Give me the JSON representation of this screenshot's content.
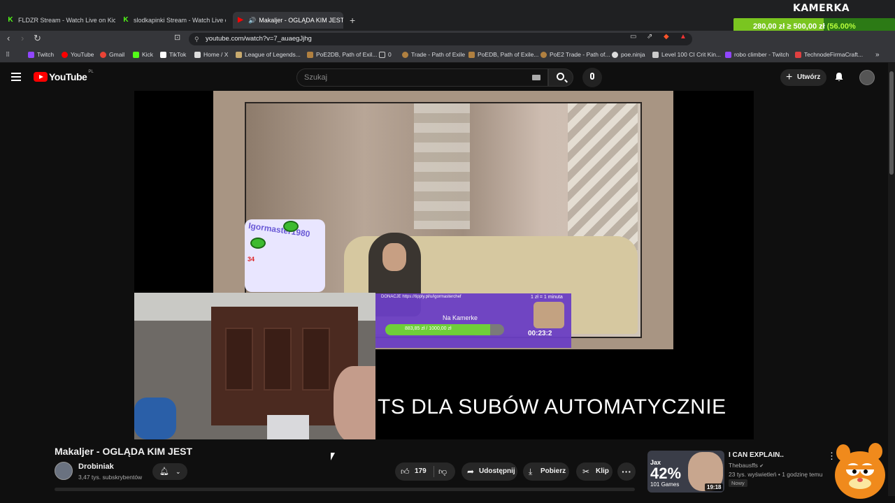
{
  "browser": {
    "tabs": [
      {
        "label": "FLDZR Stream - Watch Live on Kick",
        "favicon": "kick-icon"
      },
      {
        "label": "slodkapinki Stream - Watch Live on K",
        "favicon": "kick-icon"
      },
      {
        "label": "Makaljer - OGLĄDA KIM JEST",
        "favicon": "youtube-icon",
        "active": true
      }
    ],
    "url": "youtube.com/watch?v=7_auaegJjhg",
    "bookmarks": [
      {
        "label": "Twitch",
        "color": "#9146ff"
      },
      {
        "label": "YouTube",
        "color": "#ff0000"
      },
      {
        "label": "Gmail",
        "color": "#ea4335"
      },
      {
        "label": "Kick",
        "color": "#53fc18"
      },
      {
        "label": "TikTok",
        "color": "#ffffff"
      },
      {
        "label": "Home / X",
        "color": "#ffffff"
      },
      {
        "label": "League of Legends...",
        "color": "#c8aa6e"
      },
      {
        "label": "PoE2DB, Path of Exil...",
        "color": "#b08040"
      },
      {
        "label": "0",
        "color": "#888888"
      },
      {
        "label": "Trade - Path of Exile",
        "color": "#b08040"
      },
      {
        "label": "PoEDB, Path of Exile...",
        "color": "#b08040"
      },
      {
        "label": "PoE2 Trade - Path of...",
        "color": "#b08040"
      },
      {
        "label": "poe.ninja",
        "color": "#dddddd"
      },
      {
        "label": "Level 100 CI Crit Kin...",
        "color": "#cccccc"
      },
      {
        "label": "robo climber - Twitch",
        "color": "#9146ff"
      },
      {
        "label": "TechnodeFirmaCraft...",
        "color": "#e04040"
      }
    ]
  },
  "overlay": {
    "brand": "KAMERKA",
    "goal_current": "280,00 zł",
    "goal_sep": "≥",
    "goal_target": "500,00 zł",
    "goal_pct": "(56.00%",
    "goal_fraction": 0.56
  },
  "youtube": {
    "logo_text": "YouTube",
    "logo_country": "PL",
    "search_placeholder": "Szukaj",
    "create_label": "Utwórz"
  },
  "video": {
    "badge_name": "Igormaster1980",
    "badge_num": "34",
    "donate_url": "DONACJE   https://tipply.pl/u/igormasterchef",
    "donate_rate": "1 zł = 1 minuta",
    "donate_title": "Na Kamerke",
    "donate_current": "883,85 zł",
    "donate_target": "1000,00 zł",
    "donate_fraction": 0.88,
    "donate_timer": "00:23:2",
    "subtitle": "TS DLA SUBÓW AUTOMATYCZNIE",
    "title": "Makaljer - OGLĄDA KIM JEST",
    "channel": "Drobiniak",
    "subscribers": "3,47 tys. subskrybentów",
    "likes": "179",
    "share": "Udostępnij",
    "download": "Pobierz",
    "clip": "Klip",
    "more": "···"
  },
  "recommendation": {
    "thumb_name": "Jax",
    "thumb_pct": "42%",
    "thumb_games": "101 Games",
    "duration": "19:18",
    "title": "I CAN EXPLAIN..",
    "channel": "Thebausffs",
    "meta": "23 tys. wyświetleń • 1 godzinę temu",
    "badge": "Nowy"
  }
}
